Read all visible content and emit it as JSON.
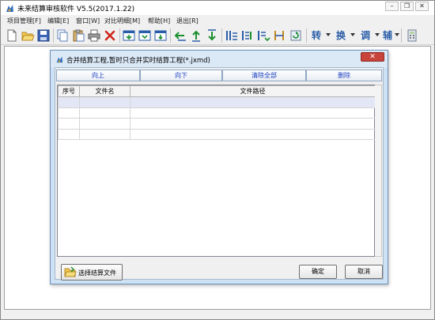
{
  "app": {
    "title": "未来结算审核软件 V5.5(2017.1.22)",
    "icon": "app-logo-icon"
  },
  "window_controls": {
    "minimize": "–",
    "restore": "❐",
    "close": "✕"
  },
  "menu": [
    {
      "label": "项目管理[F]"
    },
    {
      "label": "编辑[E]"
    },
    {
      "label": "窗口[W]"
    },
    {
      "label": "对比明细[M]"
    },
    {
      "label": "帮助[H]"
    },
    {
      "label": "退出[R]"
    }
  ],
  "toolbar": {
    "buttons": [
      {
        "icon": "new-file-icon"
      },
      {
        "icon": "open-folder-icon"
      },
      {
        "icon": "save-icon"
      },
      {
        "icon": "copy-icon"
      },
      {
        "icon": "paste-icon"
      },
      {
        "icon": "print-icon"
      },
      {
        "icon": "delete-icon"
      },
      {
        "icon": "window-down-icon"
      },
      {
        "icon": "window-insert-icon"
      },
      {
        "icon": "window-add-icon"
      },
      {
        "icon": "move-left-icon"
      },
      {
        "icon": "move-up-icon"
      },
      {
        "icon": "move-down-icon"
      },
      {
        "icon": "column-tool-1-icon"
      },
      {
        "icon": "column-tool-2-icon"
      },
      {
        "icon": "column-tool-3-icon"
      },
      {
        "icon": "column-tool-4-icon"
      },
      {
        "icon": "refresh-icon"
      }
    ],
    "text_buttons": [
      {
        "label": "转"
      },
      {
        "label": "换"
      },
      {
        "label": "调"
      },
      {
        "label": "辅"
      }
    ],
    "calculator_icon": "calculator-icon"
  },
  "dialog": {
    "title": "合并结算工程,暂时只合并实时结算工程(*.jxmd)",
    "close_label": "✕",
    "actions": [
      {
        "label": "向上"
      },
      {
        "label": "向下"
      },
      {
        "label": "清除全部"
      },
      {
        "label": "删除"
      }
    ],
    "table": {
      "columns": [
        "序号",
        "文件名",
        "文件路径"
      ],
      "rows": [
        [
          "",
          "",
          ""
        ],
        [
          "",
          "",
          ""
        ],
        [
          "",
          "",
          ""
        ],
        [
          "",
          "",
          ""
        ]
      ]
    },
    "select_file_label": "选择结算文件",
    "ok_label": "确定",
    "cancel_label": "取消"
  }
}
